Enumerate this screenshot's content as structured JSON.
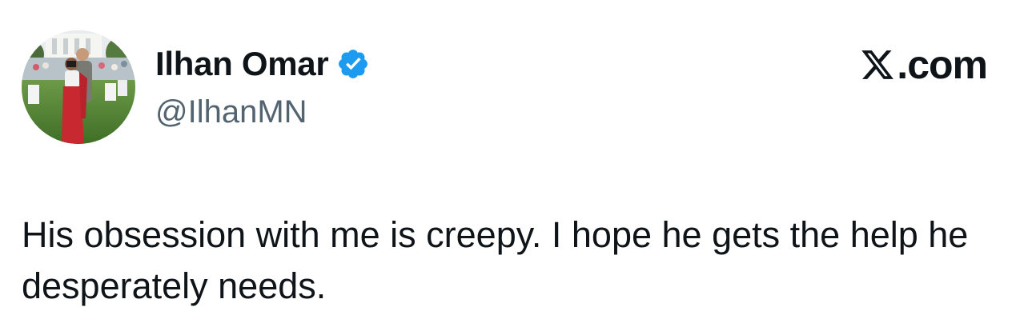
{
  "author": {
    "display_name": "Ilhan Omar",
    "handle": "@IlhanMN",
    "verified": true,
    "verified_icon": "verified-check-icon",
    "avatar_icon": "profile-photo"
  },
  "site": {
    "logo_icon": "x-logo-icon",
    "domain": ".com"
  },
  "tweet": {
    "text": "His obsession with me is creepy. I hope he gets the help he desperately needs."
  },
  "colors": {
    "text_primary": "#0f1419",
    "text_secondary": "#536471",
    "verified_blue": "#1d9bf0",
    "background": "#ffffff"
  }
}
